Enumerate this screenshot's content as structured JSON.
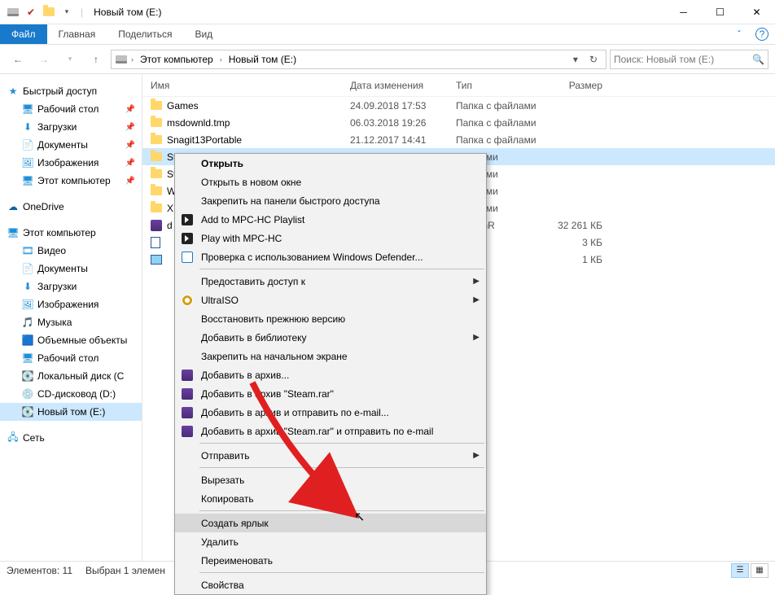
{
  "window": {
    "title": "Новый том (E:)",
    "qat_separator": "|"
  },
  "ribbon": {
    "file": "Файл",
    "tabs": [
      "Главная",
      "Поделиться",
      "Вид"
    ]
  },
  "nav": {
    "breadcrumbs": [
      "Этот компьютер",
      "Новый том (E:)"
    ],
    "search_placeholder": "Поиск: Новый том (E:)"
  },
  "sidebar": {
    "quick": "Быстрый доступ",
    "quick_items": [
      "Рабочий стол",
      "Загрузки",
      "Документы",
      "Изображения",
      "Этот компьютер"
    ],
    "onedrive": "OneDrive",
    "thispc": "Этот компьютер",
    "thispc_items": [
      "Видео",
      "Документы",
      "Загрузки",
      "Изображения",
      "Музыка",
      "Объемные объекты",
      "Рабочий стол",
      "Локальный диск (C",
      "CD-дисковод (D:)",
      "Новый том (E:)"
    ],
    "network": "Сеть"
  },
  "columns": {
    "name": "Имя",
    "date": "Дата изменения",
    "type": "Тип",
    "size": "Размер"
  },
  "rows": [
    {
      "icon": "folder",
      "name": "Games",
      "date": "24.09.2018 17:53",
      "type": "Папка с файлами",
      "size": ""
    },
    {
      "icon": "folder",
      "name": "msdownld.tmp",
      "date": "06.03.2018 19:26",
      "type": "Папка с файлами",
      "size": ""
    },
    {
      "icon": "folder",
      "name": "Snagit13Portable",
      "date": "21.12.2017 14:41",
      "type": "Папка с файлами",
      "size": ""
    },
    {
      "icon": "folder",
      "name": "St",
      "date": "",
      "type": "файлами",
      "size": "",
      "sel": true
    },
    {
      "icon": "folder",
      "name": "St",
      "date": "",
      "type": "файлами",
      "size": ""
    },
    {
      "icon": "folder",
      "name": "W",
      "date": "",
      "type": "файлами",
      "size": ""
    },
    {
      "icon": "folder",
      "name": "X",
      "date": "",
      "type": "файлами",
      "size": ""
    },
    {
      "icon": "rar",
      "name": "d",
      "date": "",
      "type": "P - WinR",
      "size": "32 261 КБ"
    },
    {
      "icon": "doc",
      "name": "",
      "date": "",
      "type": "",
      "size": "3 КБ"
    },
    {
      "icon": "img",
      "name": "",
      "date": "",
      "type": "",
      "size": "1 КБ"
    }
  ],
  "context": {
    "groups": [
      [
        {
          "label": "Открыть",
          "bold": true
        },
        {
          "label": "Открыть в новом окне"
        },
        {
          "label": "Закрепить на панели быстрого доступа"
        },
        {
          "label": "Add to MPC-HC Playlist",
          "icon": "mpc"
        },
        {
          "label": "Play with MPC-HC",
          "icon": "mpc"
        },
        {
          "label": "Проверка с использованием Windows Defender...",
          "icon": "def"
        }
      ],
      [
        {
          "label": "Предоставить доступ к",
          "sub": true
        },
        {
          "label": "UltraISO",
          "icon": "iso",
          "sub": true
        },
        {
          "label": "Восстановить прежнюю версию"
        },
        {
          "label": "Добавить в библиотеку",
          "sub": true
        },
        {
          "label": "Закрепить на начальном экране"
        },
        {
          "label": "Добавить в архив...",
          "icon": "rar"
        },
        {
          "label": "Добавить в архив \"Steam.rar\"",
          "icon": "rar"
        },
        {
          "label": "Добавить в архив и отправить по e-mail...",
          "icon": "rar"
        },
        {
          "label": "Добавить в архив \"Steam.rar\" и отправить по e-mail",
          "icon": "rar"
        }
      ],
      [
        {
          "label": "Отправить",
          "sub": true
        }
      ],
      [
        {
          "label": "Вырезать"
        },
        {
          "label": "Копировать"
        }
      ],
      [
        {
          "label": "Создать ярлык",
          "hover": true
        },
        {
          "label": "Удалить"
        },
        {
          "label": "Переименовать"
        }
      ],
      [
        {
          "label": "Свойства"
        }
      ]
    ]
  },
  "status": {
    "count": "Элементов: 11",
    "sel": "Выбран 1 элемен"
  }
}
